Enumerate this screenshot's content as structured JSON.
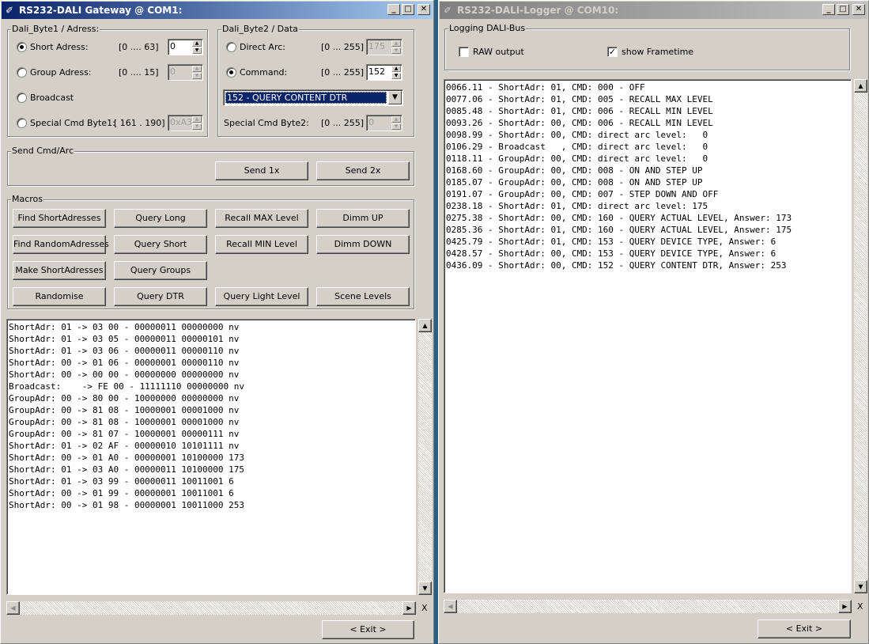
{
  "gateway": {
    "title": "RS232-DALI Gateway @ COM1:",
    "byte1": {
      "title": "Dali_Byte1 / Adress:",
      "short": {
        "label": "Short Adress:",
        "range": "[0 .... 63]",
        "value": "0"
      },
      "group": {
        "label": "Group Adress:",
        "range": "[0 .... 15]",
        "value": "0"
      },
      "broadcast": {
        "label": "Broadcast"
      },
      "special": {
        "label": "Special Cmd Byte1:",
        "range": "[ 161 . 190]",
        "value": "0xA3"
      }
    },
    "byte2": {
      "title": "Dali_Byte2 / Data",
      "direct": {
        "label": "Direct Arc:",
        "range": "[0 ... 255]",
        "value": "175"
      },
      "command": {
        "label": "Command:",
        "range": "[0 ... 255]",
        "value": "152"
      },
      "dropdown": "152 - QUERY CONTENT DTR",
      "special": {
        "label": "Special Cmd Byte2:",
        "range": "[0 ... 255]",
        "value": "0"
      }
    },
    "send": {
      "title": "Send Cmd/Arc",
      "send1": "Send 1x",
      "send2": "Send 2x"
    },
    "macros": {
      "title": "Macros",
      "find_short": "Find ShortAdresses",
      "query_long": "Query Long",
      "recall_max": "Recall MAX Level",
      "dimm_up": "Dimm UP",
      "find_random": "Find RandomAdresses",
      "query_short": "Query Short",
      "recall_min": "Recall MIN Level",
      "dimm_down": "Dimm DOWN",
      "make_short": "Make ShortAdresses",
      "query_groups": "Query Groups",
      "randomise": "Randomise",
      "query_dtr": "Query DTR",
      "query_light": "Query Light Level",
      "scene_levels": "Scene Levels"
    },
    "log": [
      "ShortAdr: 01 -> 03 00 - 00000011 00000000 nv",
      "ShortAdr: 01 -> 03 05 - 00000011 00000101 nv",
      "ShortAdr: 01 -> 03 06 - 00000011 00000110 nv",
      "ShortAdr: 00 -> 01 06 - 00000001 00000110 nv",
      "ShortAdr: 00 -> 00 00 - 00000000 00000000 nv",
      "Broadcast:    -> FE 00 - 11111110 00000000 nv",
      "GroupAdr: 00 -> 80 00 - 10000000 00000000 nv",
      "GroupAdr: 00 -> 81 08 - 10000001 00001000 nv",
      "GroupAdr: 00 -> 81 08 - 10000001 00001000 nv",
      "GroupAdr: 00 -> 81 07 - 10000001 00000111 nv",
      "ShortAdr: 01 -> 02 AF - 00000010 10101111 nv",
      "ShortAdr: 00 -> 01 A0 - 00000001 10100000 173",
      "ShortAdr: 01 -> 03 A0 - 00000011 10100000 175",
      "ShortAdr: 01 -> 03 99 - 00000011 10011001 6",
      "ShortAdr: 00 -> 01 99 - 00000001 10011001 6",
      "ShortAdr: 00 -> 01 98 - 00000001 10011000 253"
    ],
    "x_label": "X",
    "exit": "< Exit >"
  },
  "logger": {
    "title": "RS232-DALI-Logger @ COM10:",
    "group_title": "Logging DALI-Bus",
    "raw_label": "RAW output",
    "raw_checked": false,
    "frametime_label": "show Frametime",
    "frametime_checked": true,
    "check_mark": "✓",
    "log": [
      "0066.11 - ShortAdr: 01, CMD: 000 - OFF",
      "0077.06 - ShortAdr: 01, CMD: 005 - RECALL MAX LEVEL",
      "0085.48 - ShortAdr: 01, CMD: 006 - RECALL MIN LEVEL",
      "0093.26 - ShortAdr: 00, CMD: 006 - RECALL MIN LEVEL",
      "0098.99 - ShortAdr: 00, CMD: direct arc level:   0",
      "0106.29 - Broadcast   , CMD: direct arc level:   0",
      "0118.11 - GroupAdr: 00, CMD: direct arc level:   0",
      "0168.60 - GroupAdr: 00, CMD: 008 - ON AND STEP UP",
      "0185.07 - GroupAdr: 00, CMD: 008 - ON AND STEP UP",
      "0191.07 - GroupAdr: 00, CMD: 007 - STEP DOWN AND OFF",
      "0238.18 - ShortAdr: 01, CMD: direct arc level: 175",
      "0275.38 - ShortAdr: 00, CMD: 160 - QUERY ACTUAL LEVEL, Answer: 173",
      "0285.36 - ShortAdr: 01, CMD: 160 - QUERY ACTUAL LEVEL, Answer: 175",
      "0425.79 - ShortAdr: 01, CMD: 153 - QUERY DEVICE TYPE, Answer: 6",
      "0428.57 - ShortAdr: 00, CMD: 153 - QUERY DEVICE TYPE, Answer: 6",
      "0436.09 - ShortAdr: 00, CMD: 152 - QUERY CONTENT DTR, Answer: 253"
    ],
    "x_label": "X",
    "exit": "< Exit >"
  }
}
